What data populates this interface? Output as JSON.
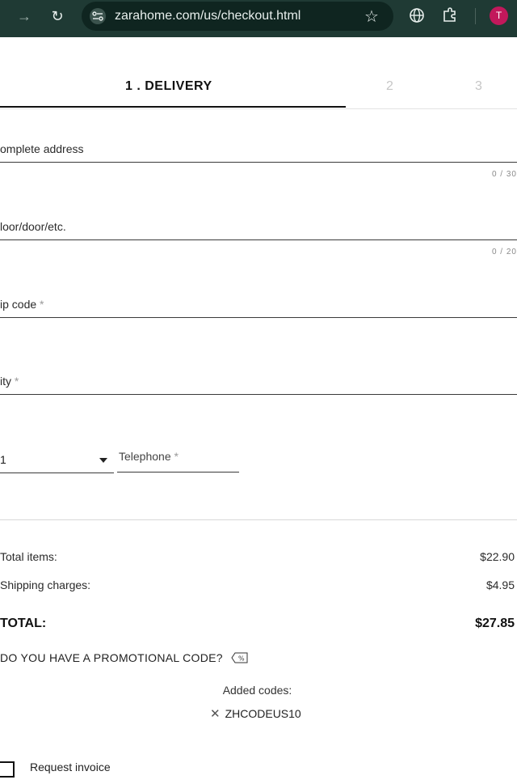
{
  "browser": {
    "url": "zarahome.com/us/checkout.html",
    "avatar_initial": "T"
  },
  "steps": {
    "step1": "1 . DELIVERY",
    "step2": "2",
    "step3": "3"
  },
  "form": {
    "address_label": "omplete address",
    "address_counter": "0 / 30",
    "floor_label": "loor/door/etc.",
    "floor_counter": "0 / 20",
    "zip_label": "ip code",
    "city_label": "ity",
    "required_mark": "*",
    "country_code_value": "1",
    "telephone_label": "Telephone"
  },
  "summary": {
    "total_items_label": "Total items:",
    "total_items_value": "$22.90",
    "shipping_label": "Shipping charges:",
    "shipping_value": "$4.95",
    "total_label": "TOTAL:",
    "total_value": "$27.85"
  },
  "promo": {
    "question": "DO YOU HAVE A PROMOTIONAL CODE?",
    "added_label": "Added codes:",
    "code": "ZHCODEUS10"
  },
  "invoice": {
    "label": "Request invoice"
  }
}
